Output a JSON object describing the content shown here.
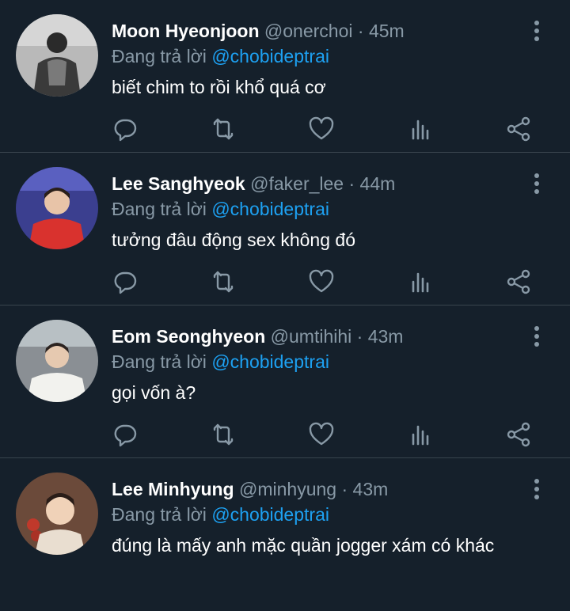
{
  "tweets": [
    {
      "name": "Moon Hyeonjoon",
      "handle": "@onerchoi",
      "dot": "·",
      "time": "45m",
      "reply_prefix": "Đang trả lời",
      "reply_to": "@chobideptrai",
      "text": "biết chim to rồi khổ quá cơ",
      "avatar_colors": {
        "bg": "#b9b9b9",
        "fg": "#2a2a2a"
      }
    },
    {
      "name": "Lee Sanghyeok",
      "handle": "@faker_lee",
      "dot": "·",
      "time": "44m",
      "reply_prefix": "Đang trả lời",
      "reply_to": "@chobideptrai",
      "text": "tưởng đâu động sex không đó",
      "avatar_colors": {
        "bg": "#3b3f8f",
        "fg": "#d9322e"
      }
    },
    {
      "name": "Eom Seonghyeon",
      "handle": "@umtihihi",
      "dot": "·",
      "time": "43m",
      "reply_prefix": "Đang trả lời",
      "reply_to": "@chobideptrai",
      "text": "gọi vốn à?",
      "avatar_colors": {
        "bg": "#8a8f94",
        "fg": "#f2f2ee"
      }
    },
    {
      "name": "Lee Minhyung",
      "handle": "@minhyung",
      "dot": "·",
      "time": "43m",
      "reply_prefix": "Đang trả lời",
      "reply_to": "@chobideptrai",
      "text": "đúng là mấy anh mặc quần jogger xám có khác",
      "avatar_colors": {
        "bg": "#6b4a3a",
        "fg": "#e9ded0"
      }
    }
  ],
  "icons": [
    "more-vertical-icon",
    "reply-icon",
    "retweet-icon",
    "like-icon",
    "analytics-icon",
    "share-icon"
  ],
  "colors": {
    "background": "#15202b",
    "secondary_text": "#8899a6",
    "mention": "#1da1f2",
    "divider": "#38444d"
  }
}
